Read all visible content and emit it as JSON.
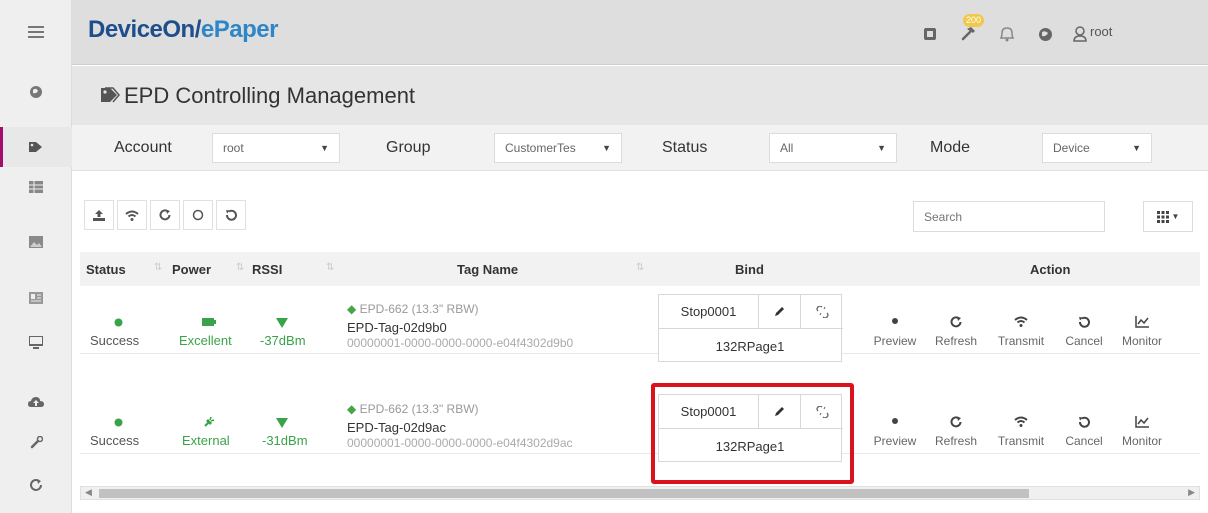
{
  "brand": {
    "part1": "DeviceOn/",
    "part2": "ePaper"
  },
  "header": {
    "notification_count": "200",
    "user": "root"
  },
  "page": {
    "title": "EPD Controlling Management"
  },
  "filters": {
    "account_label": "Account",
    "account_value": "root",
    "group_label": "Group",
    "group_value": "CustomerTes",
    "status_label": "Status",
    "status_value": "All",
    "mode_label": "Mode",
    "mode_value": "Device"
  },
  "search": {
    "placeholder": "Search"
  },
  "table": {
    "headers": {
      "status": "Status",
      "power": "Power",
      "rssi": "RSSI",
      "tag_name": "Tag Name",
      "bind": "Bind",
      "action": "Action"
    },
    "rows": [
      {
        "status": "Success",
        "power": "Excellent",
        "rssi": "-37dBm",
        "model": "EPD-662 (13.3\" RBW)",
        "tag": "EPD-Tag-02d9b0",
        "uid": "00000001-0000-0000-0000-e04f4302d9b0",
        "bind_name": "Stop0001",
        "bind_page": "132RPage1"
      },
      {
        "status": "Success",
        "power": "External",
        "rssi": "-31dBm",
        "model": "EPD-662 (13.3\" RBW)",
        "tag": "EPD-Tag-02d9ac",
        "uid": "00000001-0000-0000-0000-e04f4302d9ac",
        "bind_name": "Stop0001",
        "bind_page": "132RPage1"
      }
    ]
  },
  "actions": {
    "preview": "Preview",
    "refresh": "Refresh",
    "transmit": "Transmit",
    "cancel": "Cancel",
    "monitor": "Monitor"
  },
  "colors": {
    "brand_dark": "#1f4e8c",
    "brand_light": "#2e86c7",
    "success": "#39a34a",
    "highlight": "#d9121c"
  }
}
